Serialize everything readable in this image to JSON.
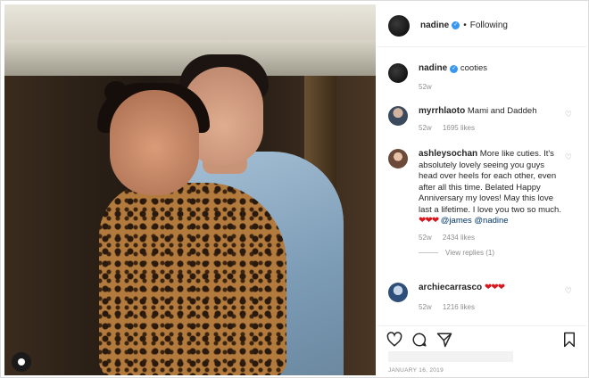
{
  "post": {
    "username": "nadine",
    "verified": true,
    "separator": "•",
    "follow_state": "Following",
    "caption": "cooties",
    "caption_age": "52w",
    "date": "JANUARY 16, 2019"
  },
  "comments": [
    {
      "username": "myrrhlaoto",
      "text": "Mami and Daddeh",
      "age": "52w",
      "likes": "1695 likes"
    },
    {
      "username": "ashleysochan",
      "text": "More like cuties. It's absolutely lovely seeing you guys head over heels for each other, even after all this time. Belated Happy Anniversary my loves! May this love last a lifetime. I love you two so much.",
      "emoji": "❤❤❤",
      "mentions": "@james @nadine",
      "age": "52w",
      "likes": "2434 likes",
      "view_replies": "View replies (1)"
    },
    {
      "username": "archiecarrasco",
      "emoji": "❤❤❤",
      "age": "52w",
      "likes": "1216 likes"
    }
  ],
  "icons": {
    "like": "heart-outline-icon",
    "comment": "comment-bubble-icon",
    "share": "paper-plane-icon",
    "save": "bookmark-icon",
    "tag": "user-tag-icon"
  },
  "colors": {
    "verified": "#3897f0",
    "heart_emoji": "#d8161d",
    "muted_text": "#8e8e8e",
    "mention": "#003569"
  }
}
